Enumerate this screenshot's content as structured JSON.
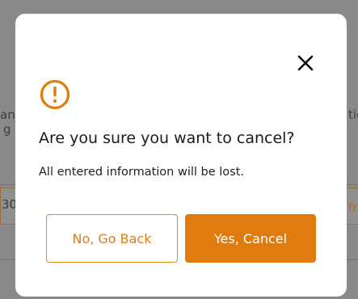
{
  "dialog": {
    "title": "Are you sure you want to cancel?",
    "message": "All entered information will be lost.",
    "close_icon": "close-icon",
    "alert_icon": "exclamation-circle-icon",
    "secondary_button_label": "No, Go Back",
    "primary_button_label": "Yes, Cancel"
  },
  "background_fragments": {
    "left_top": "an",
    "left_second": "g",
    "right_top": "tic",
    "left_mid": "30",
    "right_mid": "fr"
  },
  "colors": {
    "accent": "#e07c0e",
    "overlay": "#8a8a8a",
    "dialog_bg": "#ffffff"
  }
}
